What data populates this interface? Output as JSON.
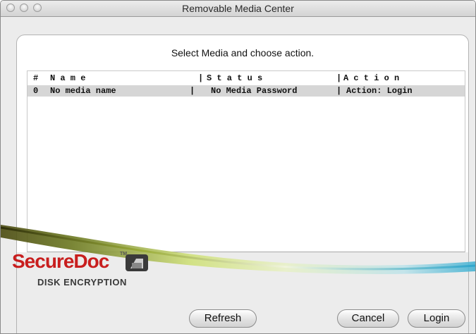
{
  "window": {
    "title": "Removable Media Center"
  },
  "instruction": "Select Media and choose action.",
  "list": {
    "header": {
      "num": "#",
      "name": "N a m e",
      "sep1": "|",
      "status": "S t a t u s",
      "sep2": "|",
      "action": "A c t i o n"
    },
    "rows": [
      {
        "num": "0",
        "name": "No media name",
        "sep1": "|",
        "status": "No Media Password",
        "sep2": "|",
        "action": "Action: Login"
      }
    ]
  },
  "logo": {
    "word": "SecureDoc",
    "tm": "TM",
    "sub": "DISK ENCRYPTION"
  },
  "buttons": {
    "refresh": "Refresh",
    "cancel": "Cancel",
    "login": "Login"
  },
  "colors": {
    "brand_red": "#c81e1e",
    "selected_row": "#d6d6d6",
    "window_bg": "#ececec"
  },
  "icons": [
    "close-light",
    "minimize-light",
    "zoom-light",
    "drive-icon"
  ]
}
